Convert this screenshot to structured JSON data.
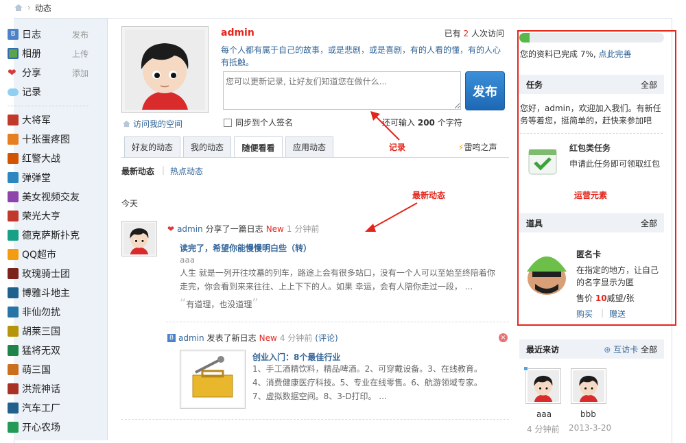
{
  "breadcrumb": {
    "current": "动态"
  },
  "sidebar": {
    "apps": [
      {
        "label": "日志",
        "action": "发布",
        "icon": "blog-icon"
      },
      {
        "label": "相册",
        "action": "上传",
        "icon": "album-icon"
      },
      {
        "label": "分享",
        "action": "添加",
        "icon": "share-icon"
      },
      {
        "label": "记录",
        "action": "",
        "icon": "record-icon"
      }
    ],
    "games": [
      "大将军",
      "十张蛋疼图",
      "红警大战",
      "弹弹堂",
      "美女视频交友",
      "荣光大亨",
      "德克萨斯扑克",
      "QQ超市",
      "玫瑰骑士团",
      "博雅斗地主",
      "非仙勿扰",
      "胡莱三国",
      "猛将无双",
      "萌三国",
      "洪荒神话",
      "汽车工厂",
      "开心农场"
    ]
  },
  "profile": {
    "name": "admin",
    "visits_prefix": "已有",
    "visits_count": "2",
    "visits_suffix": "人次访问",
    "motto": "每个人都有属于自己的故事，或是悲剧，或是喜剧，有的人看的懂，有的人心有抵触。",
    "status_placeholder": "您可以更新记录, 让好友们知道您在做什么...",
    "publish_label": "发布",
    "visit_space": "访问我的空间",
    "sync_label": "同步到个人签名",
    "remain_prefix": "还可输入",
    "remain_count": "200",
    "remain_suffix": "个字符"
  },
  "tabs": [
    "好友的动态",
    "我的动态",
    "随便看看",
    "应用动态"
  ],
  "active_tab": "随便看看",
  "thunder_label": "雷鸣之声",
  "subtabs": {
    "latest": "最新动态",
    "hot": "热点动态"
  },
  "today_label": "今天",
  "annotations": {
    "record": "记录",
    "latest": "最新动态",
    "ops": "运营元素"
  },
  "feed": [
    {
      "user": "admin",
      "verb": "分享了一篇日志",
      "new": "New",
      "time": "1 分钟前",
      "title": "读完了，希望你能慢慢明白些（转）",
      "author": "aaa",
      "body": "人生 就是一列开往坟墓的列车，路途上会有很多站口，没有一个人可以至始至终陪着你走完，你会看到来来往往、上上下下的人。如果 幸运，会有人陪你走过一段，  ...",
      "quote": "有道理，也没道理"
    },
    {
      "user": "admin",
      "verb": "发表了新日志",
      "new": "New",
      "time": "4 分钟前",
      "comment": "(评论)",
      "title": "创业入门：8个最佳行业",
      "body": "1、手工酒精饮料，精品啤酒。2、可穿戴设备。3、在线教育。4、消费健康医疗科技。5、专业在线零售。6、航游领域专家。7、虚拟数据空间。8、3-D打印。  ..."
    }
  ],
  "right": {
    "profile_complete": "您的资料已完成 7%,",
    "complete_link": "点此完善",
    "progress": 0.07,
    "task_head": "任务",
    "all": "全部",
    "task_text": "您好，admin，欢迎加入我们。有新任务等着您，挺简单的，赶快来参加吧",
    "task_title": "红包类任务",
    "task_desc": "申请此任务即可领取红包",
    "tool_head": "道具",
    "tool_title": "匿名卡",
    "tool_desc": "在指定的地方，让自己的名字显示为匿",
    "price_prefix": "售价",
    "price": "10",
    "price_suffix": "威望/张",
    "buy": "购买",
    "gift": "赠送",
    "recent_head": "最近来访",
    "exchange_card": "互访卡",
    "visitors": [
      {
        "name": "aaa",
        "time": "4 分钟前"
      },
      {
        "name": "bbb",
        "time": "2013-3-20"
      }
    ]
  }
}
